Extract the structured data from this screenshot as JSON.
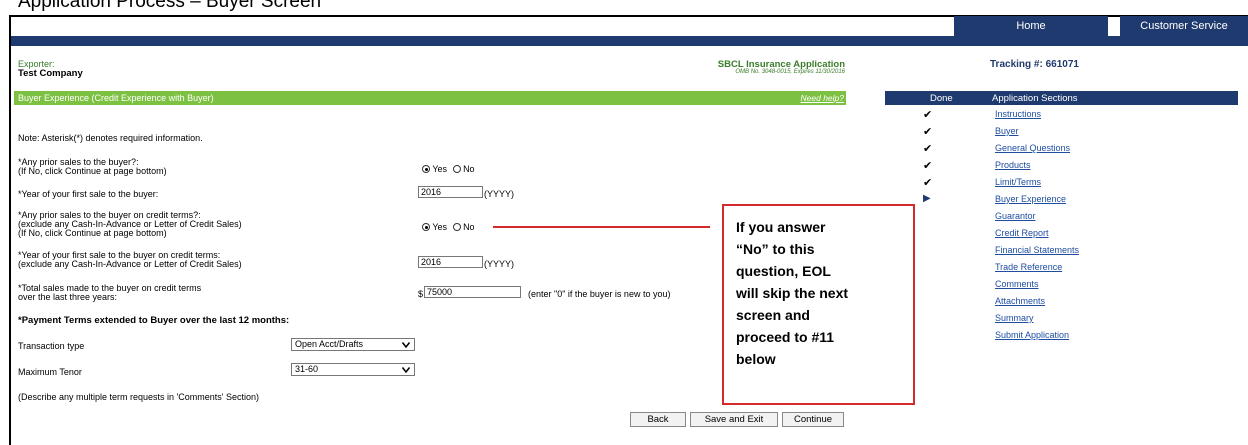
{
  "page_caption": "Application Process – Buyer Screen",
  "nav": {
    "home": "Home",
    "customer_service": "Customer Service"
  },
  "exporter": {
    "label": "Exporter:",
    "name": "Test Company"
  },
  "app": {
    "title": "SBCL Insurance Application",
    "omb": "OMB No. 3048-0015, Expires 11/30/2016",
    "tracking": "Tracking #: 661071"
  },
  "section_bar": {
    "title": "Buyer Experience (Credit Experience with Buyer)",
    "help": "Need help?"
  },
  "note": "Note: Asterisk(*) denotes required information.",
  "q1": {
    "line1": "*Any prior sales to the buyer?:",
    "line2": "(If No, click Continue at page bottom)",
    "yes": "Yes",
    "no": "No",
    "selected": "Yes"
  },
  "q2": {
    "label": "*Year of your first sale to the buyer:",
    "value": "2016",
    "hint": "(YYYY)"
  },
  "q3": {
    "line1": "*Any prior sales to the buyer on credit terms?:",
    "line2": "(exclude any Cash-In-Advance or Letter of Credit Sales)",
    "line3": "(If No, click Continue at page bottom)",
    "yes": "Yes",
    "no": "No",
    "selected": "Yes"
  },
  "q4": {
    "line1": "*Year of your first sale to the buyer on credit terms:",
    "line2": "(exclude any Cash-In-Advance or Letter of Credit Sales)",
    "value": "2016",
    "hint": "(YYYY)"
  },
  "q5": {
    "line1": "*Total sales made to the buyer on credit terms",
    "line2": "over the last three years:",
    "currency": "$",
    "value": "75000",
    "hint": "(enter \"0\" if the buyer is new to you)"
  },
  "payment": {
    "heading": "*Payment Terms extended to Buyer over the last 12 months:",
    "transaction_label": "Transaction type",
    "transaction_value": "Open Acct/Drafts",
    "tenor_label": "Maximum Tenor",
    "tenor_value": "31-60",
    "note": "(Describe any multiple term requests in 'Comments' Section)"
  },
  "buttons": {
    "back": "Back",
    "save_exit": "Save and Exit",
    "continue": "Continue"
  },
  "callout": [
    "If you answer",
    "“No” to this",
    "question, EOL",
    "will skip the next",
    "screen and",
    "proceed to #11",
    "below"
  ],
  "sections": {
    "done_header": "Done",
    "sections_header": "Application Sections",
    "items": [
      {
        "label": "Instructions",
        "done": "✔"
      },
      {
        "label": "Buyer",
        "done": "✔"
      },
      {
        "label": "General Questions",
        "done": "✔"
      },
      {
        "label": "Products",
        "done": "✔"
      },
      {
        "label": "Limit/Terms",
        "done": "✔"
      },
      {
        "label": "Buyer Experience",
        "done": "▶"
      },
      {
        "label": "Guarantor",
        "done": ""
      },
      {
        "label": "Credit Report",
        "done": ""
      },
      {
        "label": "Financial Statements",
        "done": ""
      },
      {
        "label": "Trade Reference",
        "done": ""
      },
      {
        "label": "Comments",
        "done": ""
      },
      {
        "label": "Attachments",
        "done": ""
      },
      {
        "label": "Summary",
        "done": ""
      },
      {
        "label": "Submit Application",
        "done": ""
      }
    ]
  },
  "colors": {
    "nav_blue": "#1f3a6e",
    "section_green": "#7dc142",
    "callout_red": "#d42a2a",
    "link_blue": "#1f4ea1"
  }
}
